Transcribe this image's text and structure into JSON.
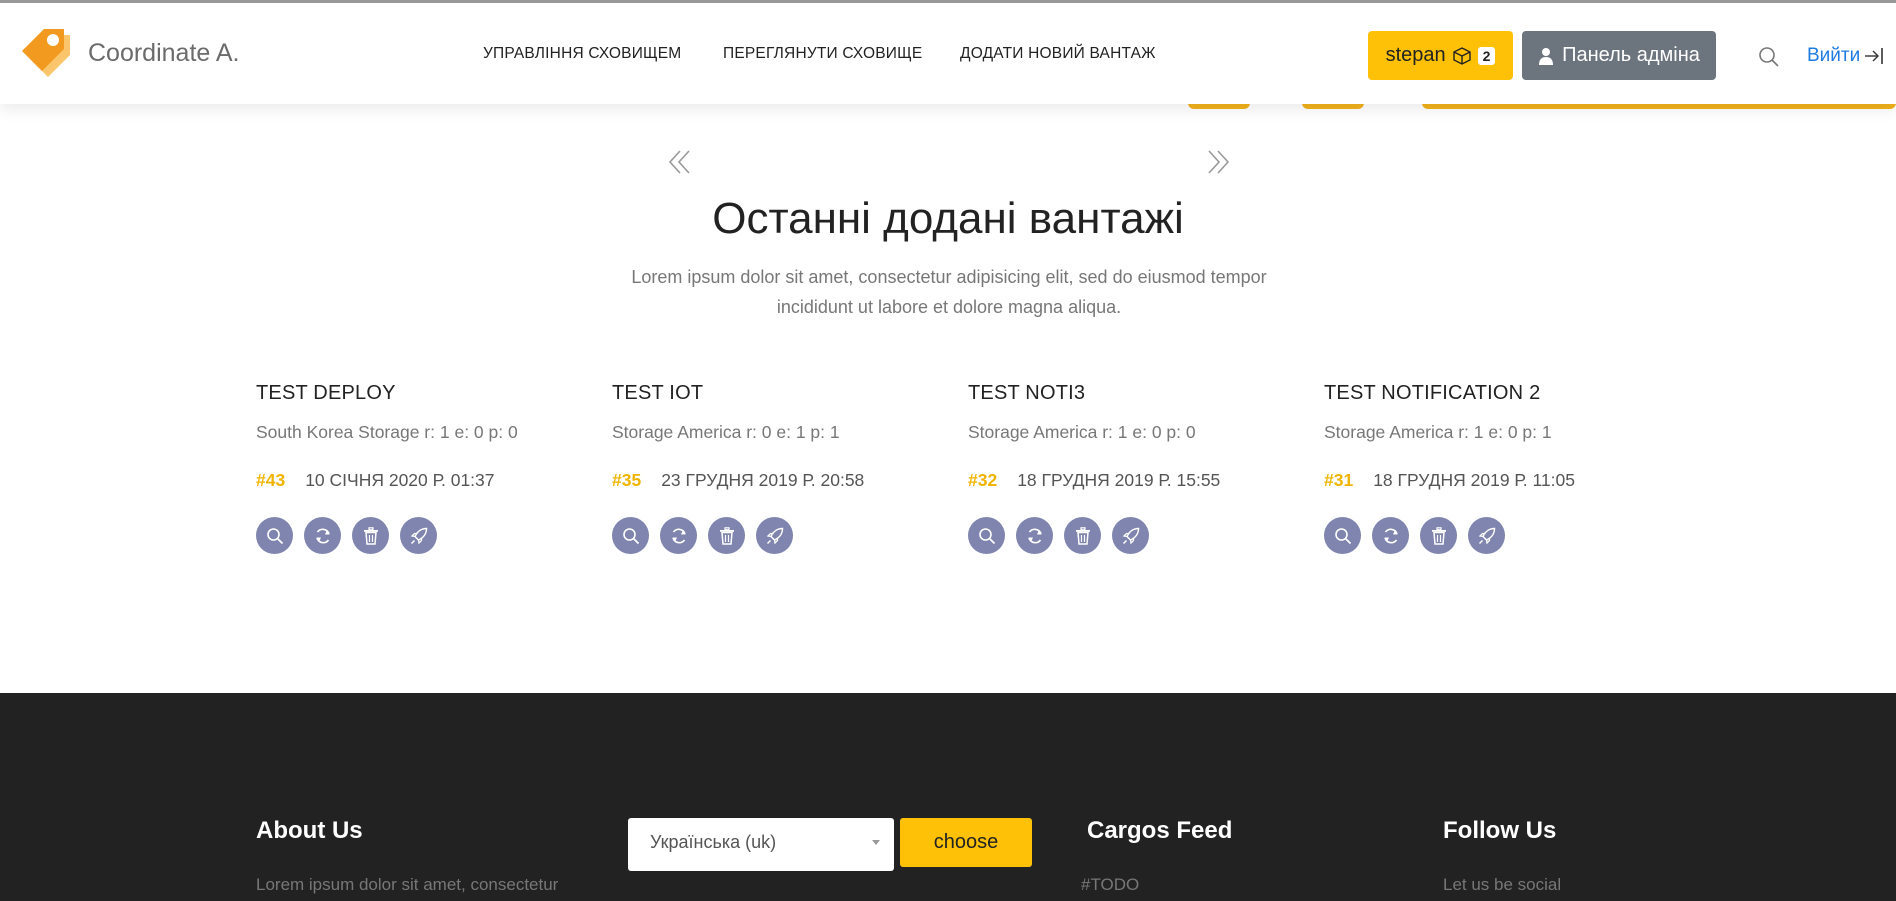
{
  "header": {
    "brand": "Coordinate A.",
    "nav": [
      "УПРАВЛІННЯ СХОВИЩЕМ",
      "ПЕРЕГЛЯНУТИ СХОВИЩЕ",
      "ДОДАТИ НОВИЙ ВАНТАЖ"
    ],
    "user_label": "stepan",
    "user_badge": "2",
    "admin_label": "Панель адміна",
    "logout_label": "Вийти"
  },
  "section": {
    "title": "Останні додані вантажі",
    "description": "Lorem ipsum dolor sit amet, consectetur adipisicing elit, sed do eiusmod tempor incididunt ut labore et dolore magna aliqua."
  },
  "cards": [
    {
      "name": "TEST DEPLOY",
      "storage": "South Korea Storage r: 1 e: 0 p: 0",
      "id": "#43",
      "date": "10 СІЧНЯ 2020 Р. 01:37"
    },
    {
      "name": "TEST IOT",
      "storage": "Storage America r: 0 e: 1 p: 1",
      "id": "#35",
      "date": "23 ГРУДНЯ 2019 Р. 20:58"
    },
    {
      "name": "TEST NOTI3",
      "storage": "Storage America r: 1 e: 0 p: 0",
      "id": "#32",
      "date": "18 ГРУДНЯ 2019 Р. 15:55"
    },
    {
      "name": "TEST NOTIFICATION 2",
      "storage": "Storage America r: 1 e: 0 p: 1",
      "id": "#31",
      "date": "18 ГРУДНЯ 2019 Р. 11:05"
    }
  ],
  "footer": {
    "about_title": "About Us",
    "about_text": "Lorem ipsum dolor sit amet, consectetur",
    "language_value": "Українська (uk)",
    "choose_label": "choose",
    "feed_title": "Cargos Feed",
    "feed_text": "#TODO",
    "follow_title": "Follow Us",
    "follow_text": "Let us be social"
  },
  "colors": {
    "accent": "#ffc107",
    "admin": "#6c757d",
    "action": "#7f85ae",
    "footer": "#222222",
    "link": "#1e7be0"
  }
}
